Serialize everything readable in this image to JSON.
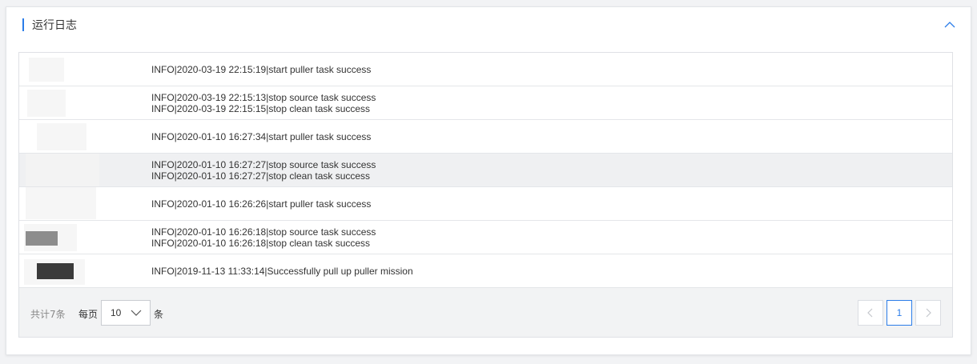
{
  "panel": {
    "title": "运行日志"
  },
  "log_rows": [
    {
      "messages": [
        "INFO|2020-03-19 22:15:19|start puller task success"
      ]
    },
    {
      "messages": [
        "INFO|2020-03-19 22:15:13|stop source task success",
        "INFO|2020-03-19 22:15:15|stop clean task success"
      ]
    },
    {
      "messages": [
        "INFO|2020-01-10 16:27:34|start puller task success"
      ]
    },
    {
      "messages": [
        "INFO|2020-01-10 16:27:27|stop source task success",
        "INFO|2020-01-10 16:27:27|stop clean task success"
      ]
    },
    {
      "messages": [
        "INFO|2020-01-10 16:26:26|start puller task success"
      ]
    },
    {
      "messages": [
        "INFO|2020-01-10 16:26:18|stop source task success",
        "INFO|2020-01-10 16:26:18|stop clean task success"
      ]
    },
    {
      "messages": [
        "INFO|2019-11-13 11:33:14|Successfully pull up puller mission"
      ]
    }
  ],
  "footer": {
    "total_text": "共计7条",
    "per_page_label": "每页",
    "page_size": "10",
    "unit_label": "条",
    "current_page": "1"
  },
  "colors": {
    "accent": "#2b7de9",
    "highlight_row": "#eff0f2"
  },
  "icons": {
    "collapse": "chevron-up-icon",
    "page_size_toggle": "chevron-down-icon",
    "prev": "chevron-left-icon",
    "next": "chevron-right-icon"
  }
}
